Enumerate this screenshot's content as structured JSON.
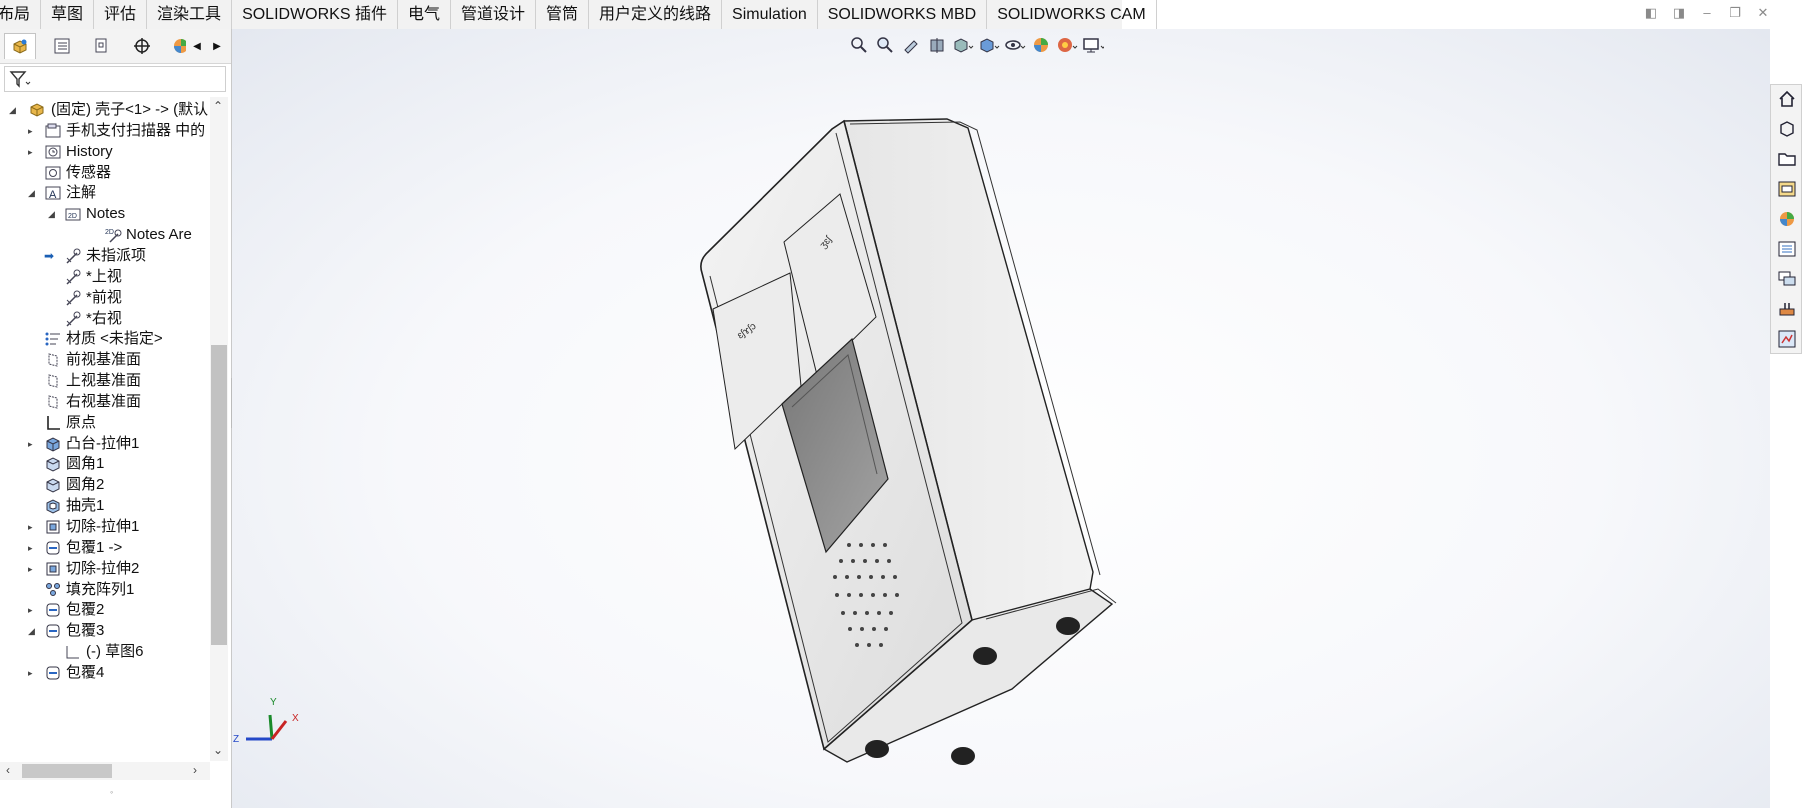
{
  "tabs": [
    "布局",
    "草图",
    "评估",
    "渲染工具",
    "SOLIDWORKS 插件",
    "电气",
    "管道设计",
    "管筒",
    "用户定义的线路",
    "Simulation",
    "SOLIDWORKS MBD",
    "SOLIDWORKS CAM"
  ],
  "window_controls": [
    "restore-left-icon",
    "restore-right-icon",
    "minimize-icon",
    "maximize-icon"
  ],
  "panel_tabs": [
    "feature-manager-icon",
    "property-manager-icon",
    "configuration-manager-icon",
    "dimxpert-icon",
    "appearance-icon"
  ],
  "tree": {
    "root": "(固定) 壳子<1> -> (默认",
    "items": [
      {
        "label": "手机支付扫描器 中的",
        "icon": "folder-icon",
        "indent": 1,
        "expand": "collapsed"
      },
      {
        "label": "History",
        "icon": "history-icon",
        "indent": 1,
        "expand": "collapsed"
      },
      {
        "label": "传感器",
        "icon": "sensor-icon",
        "indent": 1,
        "expand": "none"
      },
      {
        "label": "注解",
        "icon": "annotation-icon",
        "indent": 1,
        "expand": "expanded"
      },
      {
        "label": "Notes",
        "icon": "notes-folder-icon",
        "indent": 2,
        "expand": "expanded"
      },
      {
        "label": "Notes Are",
        "icon": "notes-area-icon",
        "indent": 4,
        "expand": "none"
      },
      {
        "label": "未指派项",
        "icon": "view-icon",
        "indent": 2,
        "expand": "pointer"
      },
      {
        "label": "*上视",
        "icon": "view-icon",
        "indent": 2,
        "expand": "none"
      },
      {
        "label": "*前视",
        "icon": "view-icon",
        "indent": 2,
        "expand": "none"
      },
      {
        "label": "*右视",
        "icon": "view-icon",
        "indent": 2,
        "expand": "none"
      },
      {
        "label": "材质 <未指定>",
        "icon": "material-icon",
        "indent": 1,
        "expand": "none"
      },
      {
        "label": "前视基准面",
        "icon": "plane-icon",
        "indent": 1,
        "expand": "none"
      },
      {
        "label": "上视基准面",
        "icon": "plane-icon",
        "indent": 1,
        "expand": "none"
      },
      {
        "label": "右视基准面",
        "icon": "plane-icon",
        "indent": 1,
        "expand": "none"
      },
      {
        "label": "原点",
        "icon": "origin-icon",
        "indent": 1,
        "expand": "none"
      },
      {
        "label": "凸台-拉伸1",
        "icon": "boss-extrude-icon",
        "indent": 1,
        "expand": "collapsed"
      },
      {
        "label": "圆角1",
        "icon": "fillet-icon",
        "indent": 1,
        "expand": "none"
      },
      {
        "label": "圆角2",
        "icon": "fillet-icon",
        "indent": 1,
        "expand": "none"
      },
      {
        "label": "抽壳1",
        "icon": "shell-icon",
        "indent": 1,
        "expand": "none"
      },
      {
        "label": "切除-拉伸1",
        "icon": "cut-extrude-icon",
        "indent": 1,
        "expand": "collapsed"
      },
      {
        "label": "包覆1 ->",
        "icon": "wrap-icon",
        "indent": 1,
        "expand": "collapsed"
      },
      {
        "label": "切除-拉伸2",
        "icon": "cut-extrude-icon",
        "indent": 1,
        "expand": "collapsed"
      },
      {
        "label": "填充阵列1",
        "icon": "fill-pattern-icon",
        "indent": 1,
        "expand": "none"
      },
      {
        "label": "包覆2",
        "icon": "wrap-icon",
        "indent": 1,
        "expand": "collapsed"
      },
      {
        "label": "包覆3",
        "icon": "wrap-icon",
        "indent": 1,
        "expand": "expanded"
      },
      {
        "label": "(-) 草图6",
        "icon": "sketch-icon",
        "indent": 2,
        "expand": "none"
      },
      {
        "label": "包覆4",
        "icon": "wrap-icon",
        "indent": 1,
        "expand": "collapsed"
      }
    ]
  },
  "triad": {
    "x": "X",
    "y": "Y",
    "z": "Z"
  },
  "view_toolbar": [
    "zoom-to-fit-icon",
    "zoom-to-area-icon",
    "previous-view-icon",
    "section-view-icon",
    "view-orientation-icon",
    "display-style-icon",
    "hide-show-items-icon",
    "edit-appearance-icon",
    "apply-scene-icon",
    "view-settings-icon"
  ],
  "task_pane": [
    "home-icon",
    "resources-icon",
    "design-library-icon",
    "file-explorer-icon",
    "appearances-icon",
    "custom-properties-icon",
    "forum-icon",
    "solidworks-cam-icon",
    "recognizer-icon"
  ],
  "colors": {
    "accent": "#0a64c8",
    "panel_bg": "#f3f3f3",
    "selection": "#cce4f7"
  }
}
